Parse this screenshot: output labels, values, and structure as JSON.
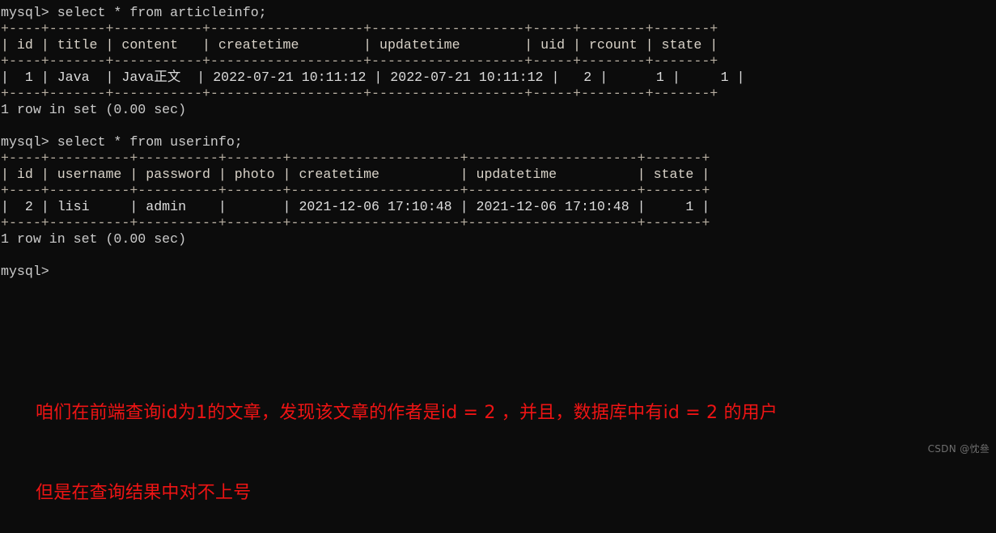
{
  "terminal": {
    "background_color": "#0c0c0c",
    "text_color": "#cccccc",
    "prompt": "mysql>",
    "blocks": [
      {
        "command": "mysql> select * from articleinfo;",
        "table": {
          "name": "articleinfo",
          "columns": [
            "id",
            "title",
            "content",
            "createtime",
            "updatetime",
            "uid",
            "rcount",
            "state"
          ],
          "widths": [
            4,
            7,
            11,
            19,
            19,
            5,
            8,
            7
          ],
          "aligns": [
            "right",
            "left",
            "left",
            "left",
            "left",
            "right",
            "right",
            "right"
          ],
          "rows": [
            [
              "1",
              "Java",
              "Java正文",
              "2022-07-21 10:11:12",
              "2022-07-21 10:11:12",
              "2",
              "1",
              "1"
            ]
          ]
        },
        "status": "1 row in set (0.00 sec)"
      },
      {
        "command": "mysql> select * from userinfo;",
        "table": {
          "name": "userinfo",
          "columns": [
            "id",
            "username",
            "password",
            "photo",
            "createtime",
            "updatetime",
            "state"
          ],
          "widths": [
            4,
            10,
            10,
            7,
            21,
            21,
            7
          ],
          "aligns": [
            "right",
            "left",
            "left",
            "left",
            "left",
            "left",
            "right"
          ],
          "rows": [
            [
              "2",
              "lisi",
              "admin",
              "",
              "2021-12-06 17:10:48",
              "2021-12-06 17:10:48",
              "1"
            ]
          ]
        },
        "status": "1 row in set (0.00 sec)"
      }
    ],
    "final_prompt": "mysql>"
  },
  "annotation": {
    "color": "#ef1414",
    "lines": [
      "咱们在前端查询id为1的文章，发现该文章的作者是id = 2 ，并且，数据库中有id = 2 的用户",
      "但是在查询结果中对不上号"
    ]
  },
  "watermark": {
    "text": "CSDN @忱叄"
  }
}
